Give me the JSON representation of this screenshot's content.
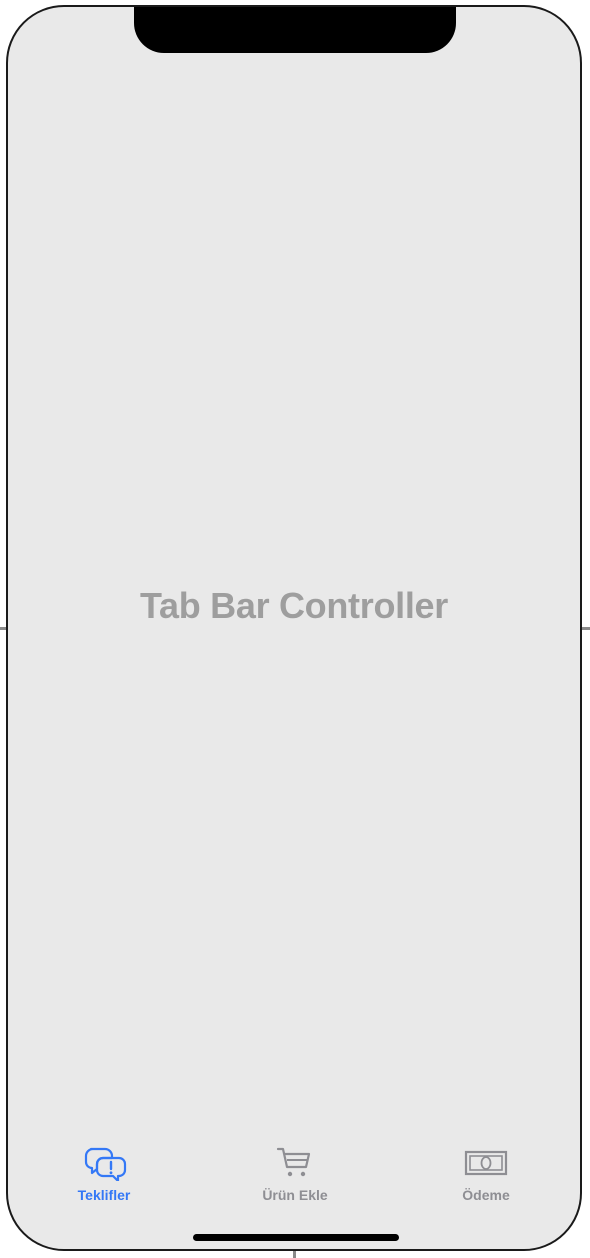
{
  "screen": {
    "title": "Tab Bar Controller"
  },
  "tabbar": {
    "active_color": "#3478f6",
    "inactive_color": "#8e8e93",
    "tabs": [
      {
        "label": "Teklifler",
        "icon": "exclamation-bubble-icon",
        "active": true
      },
      {
        "label": "Ürün Ekle",
        "icon": "cart-icon",
        "active": false
      },
      {
        "label": "Ödeme",
        "icon": "banknote-icon",
        "active": false
      }
    ]
  }
}
